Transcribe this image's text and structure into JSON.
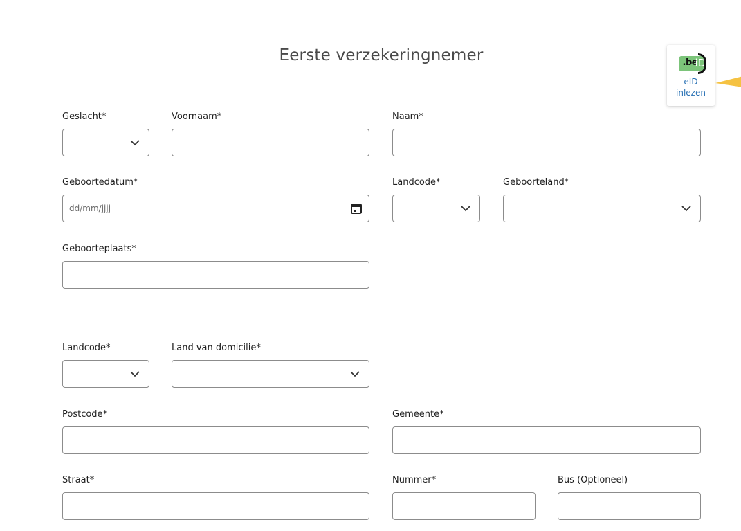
{
  "section": {
    "title": "Eerste verzekeringnemer"
  },
  "eid": {
    "logo_be": ".be",
    "logo_d": "iD",
    "label_line1": "eID",
    "label_line2": "inlezen"
  },
  "personal": {
    "geslacht_label": "Geslacht*",
    "voornaam_label": "Voornaam*",
    "naam_label": "Naam*",
    "geboortedatum_label": "Geboortedatum*",
    "geboortedatum_placeholder": "dd/mm/jjjj",
    "landcode_birth_label": "Landcode*",
    "geboorteland_label": "Geboorteland*",
    "geboorteplaats_label": "Geboorteplaats*"
  },
  "address": {
    "landcode_label": "Landcode*",
    "land_domicilie_label": "Land van domicilie*",
    "postcode_label": "Postcode*",
    "gemeente_label": "Gemeente*",
    "straat_label": "Straat*",
    "nummer_label": "Nummer*",
    "bus_label": "Bus (Optioneel)"
  },
  "colors": {
    "accent_link": "#2a72b5",
    "eid_green": "#7cc47a",
    "pointer": "#f5c242",
    "border": "#8c8c8c"
  }
}
